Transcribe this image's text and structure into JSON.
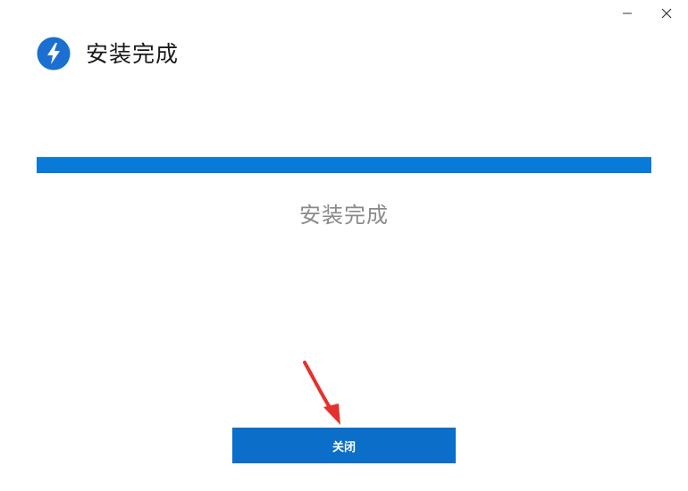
{
  "window": {
    "title": "安装完成",
    "controls": {
      "minimize_icon": "minimize-icon",
      "close_icon": "close-icon"
    },
    "app_icon": "lightning-bolt-icon"
  },
  "progress": {
    "value": 1.0,
    "color": "#0a7ad8"
  },
  "status": {
    "text": "安装完成"
  },
  "actions": {
    "close_label": "关闭",
    "close_color": "#0b6ec9"
  },
  "annotation": {
    "arrow_icon": "red-pointer-arrow-icon",
    "arrow_color": "#e5312e"
  }
}
